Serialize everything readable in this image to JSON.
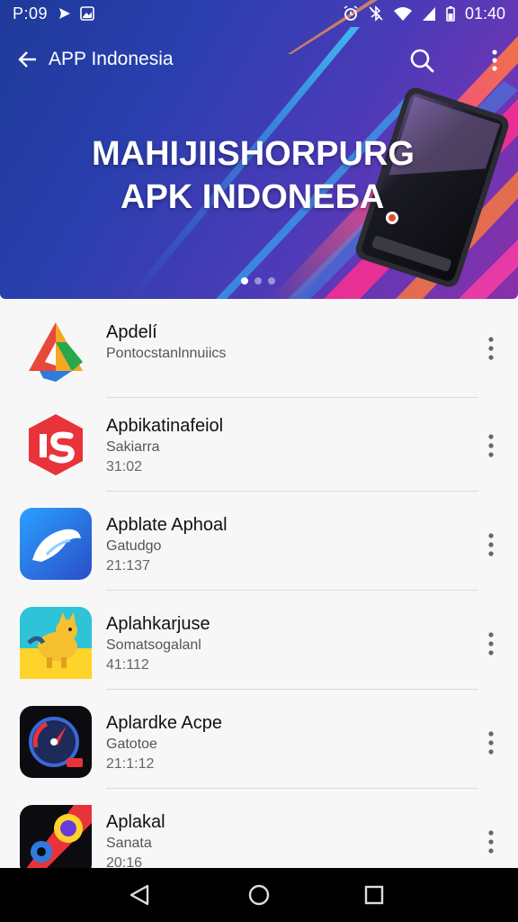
{
  "status": {
    "time": "P:09",
    "right_time": "01:40"
  },
  "appbar": {
    "title": "APP Indonesia"
  },
  "banner": {
    "line1": "MAHIJIISHORPURG",
    "line2": "APK INDONEБA",
    "slides": 3,
    "active_slide": 0
  },
  "apps": [
    {
      "name": "Apdelí",
      "subtitle": "Pontocstanlnnuiics",
      "meta": "",
      "icon": "triangle-logo-icon"
    },
    {
      "name": "Apbikatinafeiol",
      "subtitle": "Sakiarra",
      "meta": "31:02",
      "icon": "red-hexagon-icon"
    },
    {
      "name": "Apblate Aphoal",
      "subtitle": "Gatudgo",
      "meta": "21:137",
      "icon": "blue-bird-icon"
    },
    {
      "name": "Aplahkarjuse",
      "subtitle": "Somatsogalanl",
      "meta": "41:112",
      "icon": "yellow-character-icon"
    },
    {
      "name": "Aplardke Acpe",
      "subtitle": "Gatotoe",
      "meta": "21:1:12",
      "icon": "speedometer-icon"
    },
    {
      "name": "Aplakal",
      "subtitle": "Sanata",
      "meta": "20:16",
      "icon": "colorful-lens-icon"
    }
  ],
  "colors": {
    "hero_start": "#1e3a9a",
    "hero_end": "#8a2fa8",
    "accent_pink": "#ff3fa4",
    "accent_orange": "#ff7a3a",
    "list_bg": "#f7f7f7"
  }
}
